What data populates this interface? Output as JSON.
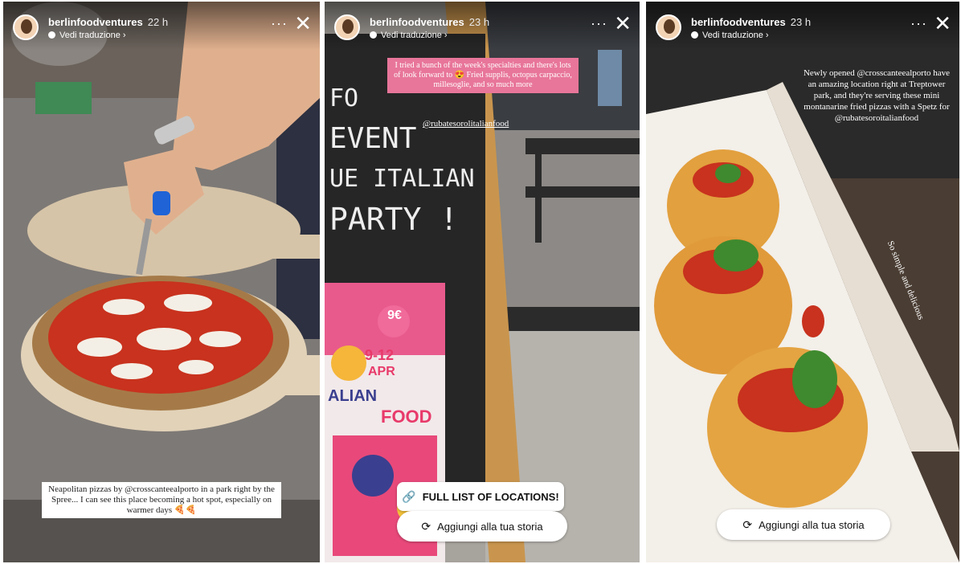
{
  "stories": [
    {
      "username": "berlinfoodventures",
      "time": "22 h",
      "translate": "Vedi traduzione",
      "caption": "Neapolitan pizzas by @crosscanteealporto in a park right by the Spree... I can see this place becoming a hot spot, especially on warmer days 🍕🍕"
    },
    {
      "username": "berlinfoodventures",
      "time": "23 h",
      "translate": "Vedi traduzione",
      "pink_caption": "I tried a bunch of the week's specialties and there's lots of look forward to 😍 Fried supplis, octopus carpaccio, millesoglie, and so much more",
      "mention": "@rubatesorolitalianfood",
      "board_lines": [
        "FO",
        "EVENT",
        "UE ITALIAN",
        "PARTY !"
      ],
      "poster": {
        "price": "9€",
        "dates": "9-12",
        "month": "APR",
        "word1": "ALIAN",
        "word2": "FOOD"
      },
      "sticker": "FULL LIST OF LOCATIONS!",
      "add_story": "Aggiungi alla tua storia"
    },
    {
      "username": "berlinfoodventures",
      "time": "23 h",
      "translate": "Vedi traduzione",
      "caption": "Newly opened @crosscanteealporto have an amazing location right at Treptower park, and they're serving these mini montanarine fried pizzas with a Spetz for @rubatesoroitalianfood",
      "side_text": "So simple and delicious",
      "add_story": "Aggiungi alla tua storia"
    }
  ],
  "icons": {
    "more": "more-dots-icon",
    "close": "close-icon",
    "link": "link-icon",
    "share": "share-refresh-icon"
  },
  "colors": {
    "pink_caption_bg": "#e8769a",
    "pill_bg": "#ffffff",
    "sticker_link": "#e8497a"
  }
}
